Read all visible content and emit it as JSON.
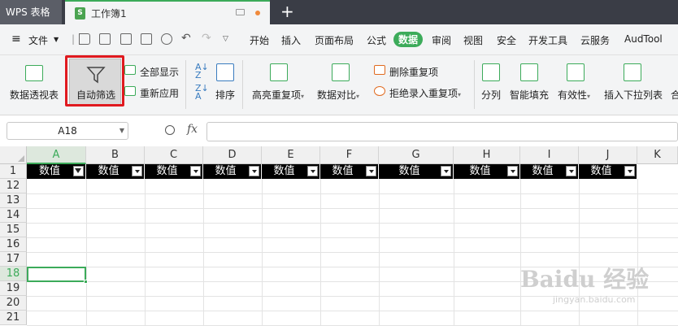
{
  "titlebar": {
    "app_name": "WPS 表格",
    "doc_name": "工作簿1",
    "new_tab": "+"
  },
  "menubar": {
    "items": [
      "文件",
      "开始",
      "插入",
      "页面布局",
      "公式",
      "数据",
      "审阅",
      "视图",
      "安全",
      "开发工具",
      "云服务",
      "AudTool"
    ],
    "active": "数据"
  },
  "ribbon": {
    "pivot": "数据透视表",
    "autofilter": "自动筛选",
    "show_all": "全部显示",
    "reapply": "重新应用",
    "sort": "排序",
    "highlight_dup": "高亮重复项",
    "compare": "数据对比",
    "remove_dup": "删除重复项",
    "reject_dup": "拒绝录入重复项",
    "split": "分列",
    "smart_fill": "智能填充",
    "validity": "有效性",
    "insert_dropdown": "插入下拉列表",
    "merge": "合"
  },
  "formula": {
    "cell_ref": "A18",
    "fx": "fx",
    "content": ""
  },
  "sheet": {
    "columns": [
      "A",
      "B",
      "C",
      "D",
      "E",
      "F",
      "G",
      "H",
      "I",
      "J",
      "K"
    ],
    "rows": [
      "1",
      "12",
      "13",
      "14",
      "15",
      "16",
      "17",
      "18",
      "19",
      "20",
      "21"
    ],
    "header_value": "数值",
    "selected_cell": "A18"
  },
  "watermark": {
    "brand": "Baidu 经验",
    "url": "jingyan.baidu.com"
  },
  "colors": {
    "accent": "#3cab5a",
    "titlebar": "#3a3d46",
    "highlight_box": "#e0191f"
  }
}
